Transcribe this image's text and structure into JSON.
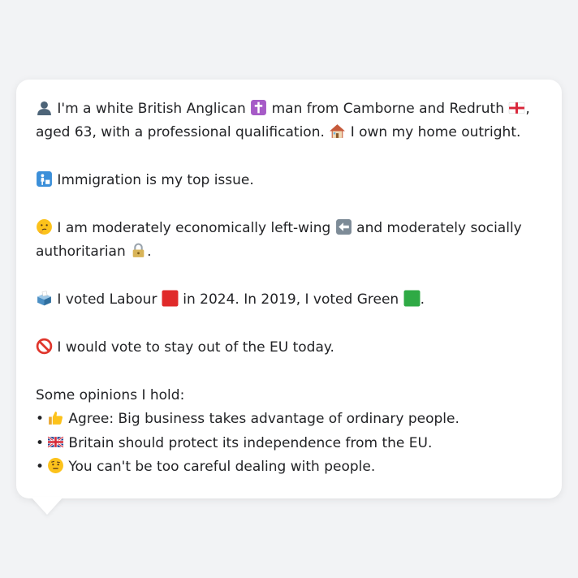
{
  "colors": {
    "background": "#f2f3f5",
    "bubble": "#ffffff",
    "text": "#222326"
  },
  "profile": {
    "intro_a": "I'm a white British Anglican",
    "intro_b": "man from Camborne and Redruth",
    "intro_c": ", aged 63, with a professional qualification.",
    "intro_d": "I own my home outright.",
    "issue": "Immigration is my top issue.",
    "ideology_a": "I am moderately economically left-wing",
    "ideology_b": "and moderately socially authoritarian",
    "ideology_c": ".",
    "vote_a": "I voted Labour",
    "vote_b": "in 2024. In 2019, I voted Green",
    "vote_c": ".",
    "eu": "I would vote to stay out of the EU today.",
    "opinions_heading": "Some opinions I hold:",
    "opinions": [
      {
        "icon": "thumbs-up-icon",
        "text": "Agree: Big business takes advantage of ordinary people."
      },
      {
        "icon": "uk-flag-icon",
        "text": "Britain should protect its independence from the EU."
      },
      {
        "icon": "raised-eyebrow-face-icon",
        "text": "You can't be too careful dealing with people."
      }
    ],
    "bullet": "•"
  },
  "icons": {
    "person": "bust-silhouette-icon",
    "religion": "latin-cross-icon",
    "region": "england-flag-icon",
    "home": "house-icon",
    "issue": "passport-control-icon",
    "thinking": "thinking-face-icon",
    "left": "left-arrow-icon",
    "authoritarian": "padlock-icon",
    "ballot": "ballot-box-icon",
    "labour": "red-square-icon",
    "green": "green-square-icon",
    "eu": "prohibited-icon"
  }
}
